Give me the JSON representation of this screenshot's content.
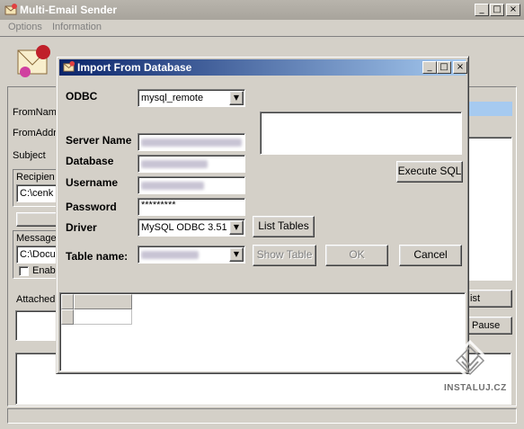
{
  "main_window": {
    "title": "Multi-Email Sender",
    "menu": [
      "Options",
      "Information"
    ],
    "bg_labels": {
      "from_name": "FromName",
      "from_address": "FromAddr",
      "subject": "Subject",
      "recipients": "Recipien",
      "recipients_path": "C:\\cenk",
      "message": "Message",
      "message_path": "C:\\Docu",
      "enable": "Enabl",
      "attached": "Attached",
      "list": "ist",
      "pause": "Pause"
    },
    "title_buttons": [
      "_",
      "□",
      "×"
    ]
  },
  "dialog": {
    "title": "Import From Database",
    "title_buttons": [
      "_",
      "□",
      "×"
    ],
    "labels": {
      "odbc": "ODBC",
      "server_name": "Server Name",
      "database": "Database",
      "username": "Username",
      "password": "Password",
      "driver": "Driver",
      "table_name": "Table name:"
    },
    "fields": {
      "odbc_value": "mysql_remote",
      "password_value": "*********",
      "driver_value": "MySQL ODBC 3.51"
    },
    "buttons": {
      "execute_sql": "Execute SQL",
      "list_tables": "List Tables",
      "show_table": "Show Table",
      "ok": "OK",
      "cancel": "Cancel"
    }
  },
  "watermark": {
    "text": "INSTALUJ.CZ"
  }
}
